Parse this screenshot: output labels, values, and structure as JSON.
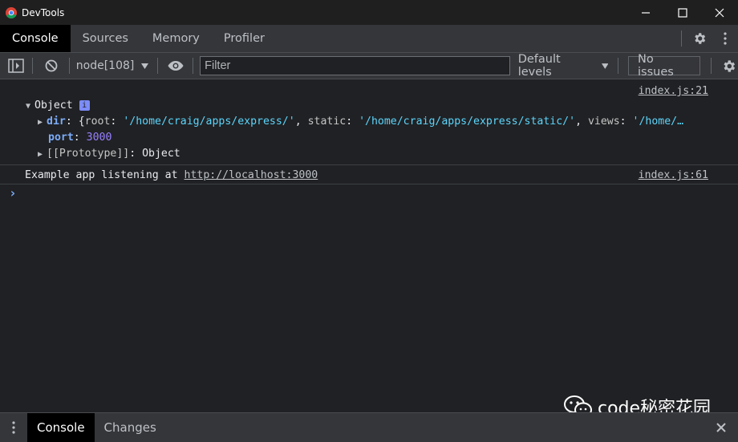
{
  "window": {
    "title": "DevTools",
    "controls": [
      "minimize-icon",
      "maximize-icon",
      "close-icon"
    ]
  },
  "tabs": [
    {
      "label": "Console",
      "active": true
    },
    {
      "label": "Sources",
      "active": false
    },
    {
      "label": "Memory",
      "active": false
    },
    {
      "label": "Profiler",
      "active": false
    }
  ],
  "toolbar": {
    "context": "node[108]",
    "filter_placeholder": "Filter",
    "levels": "Default levels",
    "issues": "No issues"
  },
  "console": {
    "object_entry": {
      "label": "Object",
      "info": "i",
      "source": "index.js:21",
      "dir_key": "dir",
      "dir_preview_open": ": {",
      "root_key": "root",
      "root_value": "'/home/craig/apps/express/'",
      "static_key": "static",
      "static_value": "'/home/craig/apps/express/static/'",
      "views_key": "views",
      "views_value": "'/home/…",
      "port_key": "port",
      "port_value": "3000",
      "proto_key": "[[Prototype]]",
      "proto_value": "Object"
    },
    "log_entry": {
      "text": "Example app listening at ",
      "link": "http://localhost:3000",
      "source": "index.js:61"
    },
    "prompt": "›"
  },
  "watermark": {
    "text": "code秘密花园"
  },
  "drawer": {
    "tabs": [
      {
        "label": "Console",
        "active": true
      },
      {
        "label": "Changes",
        "active": false
      }
    ]
  },
  "colors": {
    "background": "#202124",
    "panel": "#35363a",
    "string": "#5cd5fb",
    "number": "#9980ff",
    "key": "#7cacf8"
  }
}
